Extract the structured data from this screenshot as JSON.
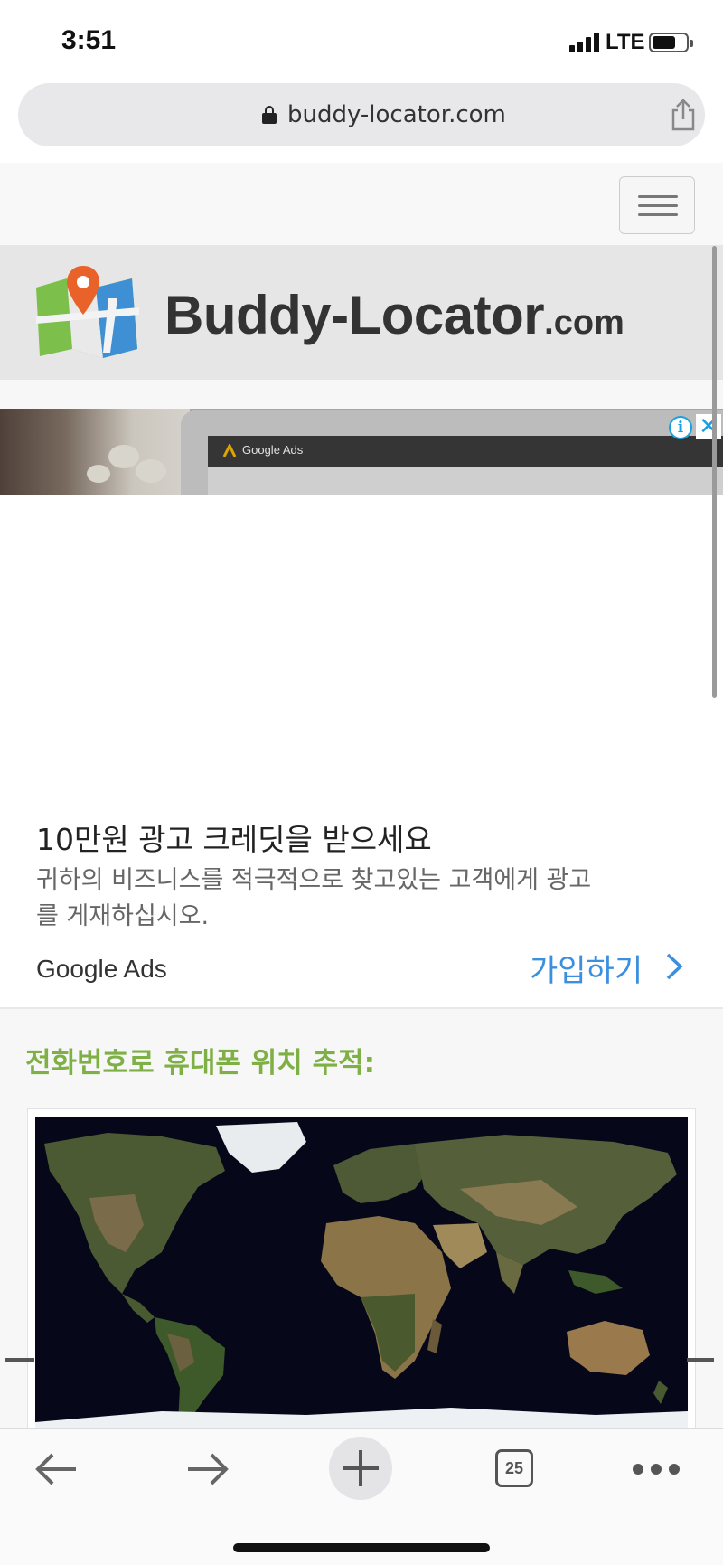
{
  "status_bar": {
    "time": "3:51",
    "network": "LTE",
    "battery_level": 0.7
  },
  "url_bar": {
    "url": "buddy-locator.com"
  },
  "site": {
    "logo_name": "Buddy-Locator",
    "logo_tld": ".com"
  },
  "ad": {
    "image_label": "Google Ads",
    "headline": "10만원 광고 크레딧을 받으세요",
    "description": "귀하의 비즈니스를 적극적으로 찾고있는 고객에게 광고를 게재하십시오.",
    "advertiser": "Google Ads",
    "cta": "가입하기",
    "cta_color": "#3b8fde"
  },
  "section": {
    "heading": "전화번호로 휴대폰 위치 추적:",
    "heading_color": "#7fb045"
  },
  "toolbar": {
    "tabs_count": "25",
    "icons": [
      "back-arrow-icon",
      "forward-arrow-icon",
      "plus-icon",
      "tabs-icon",
      "more-icon"
    ]
  }
}
